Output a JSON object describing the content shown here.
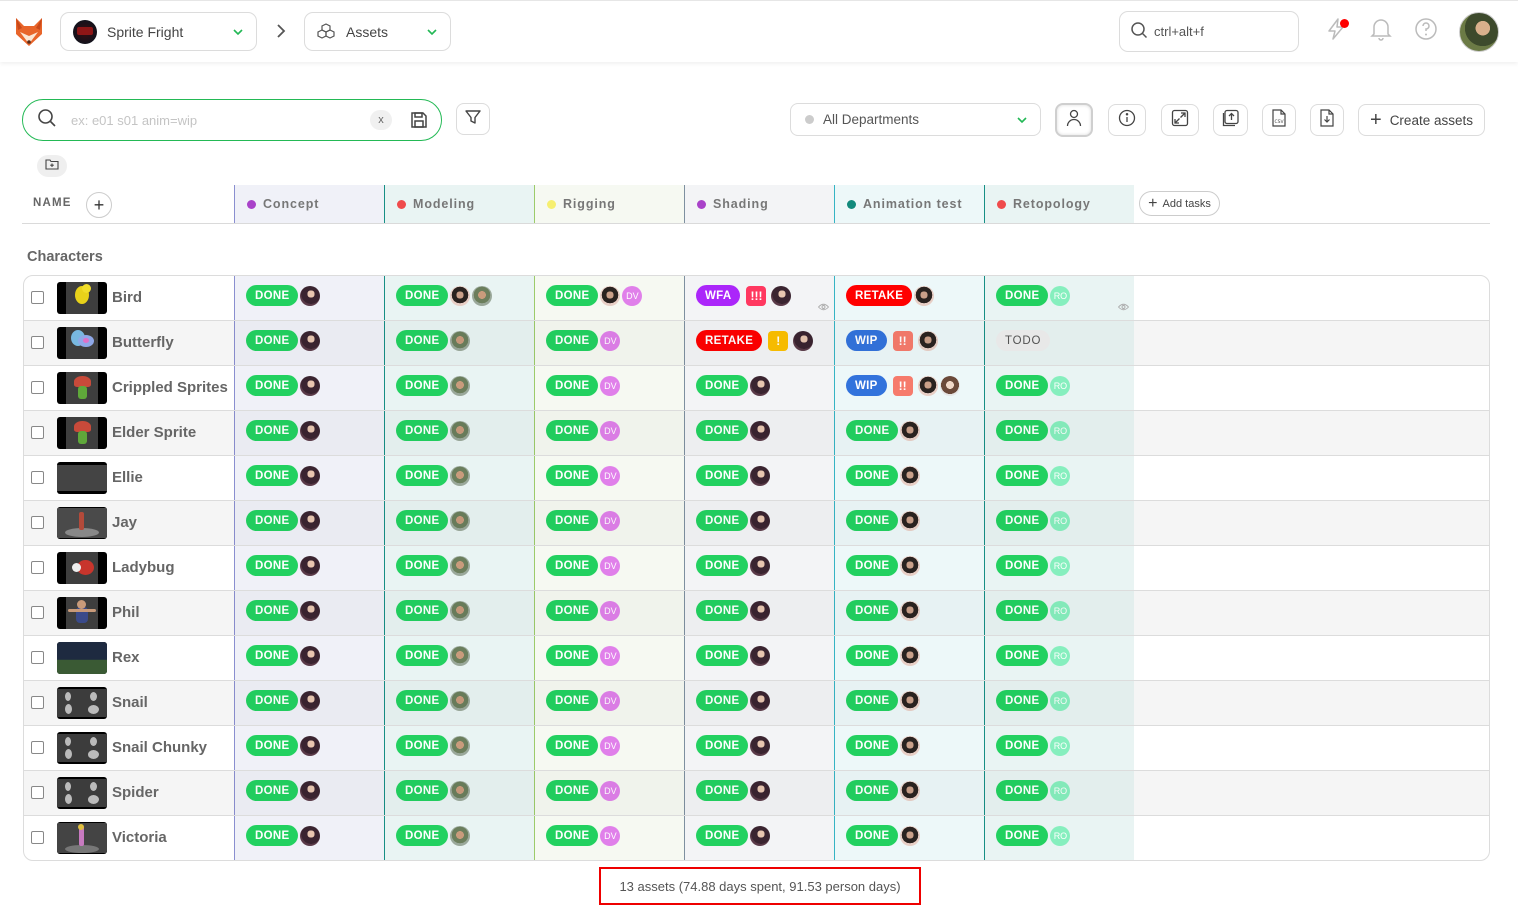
{
  "topbar": {
    "production": "Sprite Fright",
    "section": "Assets",
    "global_search_placeholder": "ctrl+alt+f"
  },
  "toolbar": {
    "search_placeholder": "ex: e01 s01 anim=wip",
    "clear_label": "x",
    "department": "All Departments",
    "create_label": "Create assets",
    "add_tasks_label": "Add tasks"
  },
  "table": {
    "name_header": "NAME",
    "group": "Characters",
    "tasks": [
      {
        "name": "Concept",
        "color": "#a942c9",
        "bg": "#f0f1f8",
        "border": "#8a8fd0"
      },
      {
        "name": "Modeling",
        "color": "#ef4b4b",
        "bg": "#e9f4f3",
        "border": "#178f85"
      },
      {
        "name": "Rigging",
        "color": "#f6ef70",
        "bg": "#f6f9f2",
        "border": "#9ccb6a"
      },
      {
        "name": "Shading",
        "color": "#a942c9",
        "bg": "#f3f4f6",
        "border": "#7e90a0"
      },
      {
        "name": "Animation test",
        "color": "#128a7c",
        "bg": "#edf8f9",
        "border": "#35b4c4"
      },
      {
        "name": "Retopology",
        "color": "#ef4b4b",
        "bg": "#e9f4f3",
        "border": "#178f85"
      }
    ],
    "status_colors": {
      "DONE": "#22d160",
      "WFA": "#ab26fa",
      "RETAKE": "#ff0000",
      "WIP": "#3273dc",
      "TODO": "#eeeeee"
    },
    "priority_colors": {
      "!!!": "#ff3860",
      "!!": "#f67b6c",
      "!": "#fcc000"
    },
    "rows": [
      {
        "name": "Bird",
        "thumb": "bird",
        "cells": [
          {
            "status": "DONE",
            "people": [
              "dark"
            ]
          },
          {
            "status": "DONE",
            "people": [
              "girl",
              "man"
            ]
          },
          {
            "status": "DONE",
            "people": [
              "girl",
              "DV"
            ]
          },
          {
            "status": "WFA",
            "priority": "!!!",
            "people": [
              "dark"
            ],
            "eye": true
          },
          {
            "status": "RETAKE",
            "people": [
              "girl"
            ]
          },
          {
            "status": "DONE",
            "people": [
              "RO"
            ],
            "eye": true
          }
        ]
      },
      {
        "name": "Butterfly",
        "thumb": "butterfly",
        "cells": [
          {
            "status": "DONE",
            "people": [
              "dark"
            ]
          },
          {
            "status": "DONE",
            "people": [
              "man"
            ]
          },
          {
            "status": "DONE",
            "people": [
              "DV"
            ]
          },
          {
            "status": "RETAKE",
            "priority": "!",
            "people": [
              "dark"
            ]
          },
          {
            "status": "WIP",
            "priority": "!!",
            "people": [
              "girl"
            ]
          },
          {
            "status": "TODO",
            "people": []
          }
        ]
      },
      {
        "name": "Crippled Sprites",
        "thumb": "mushroom",
        "cells": [
          {
            "status": "DONE",
            "people": [
              "dark"
            ]
          },
          {
            "status": "DONE",
            "people": [
              "man"
            ]
          },
          {
            "status": "DONE",
            "people": [
              "DV"
            ]
          },
          {
            "status": "DONE",
            "people": [
              "dark"
            ]
          },
          {
            "status": "WIP",
            "priority": "!!",
            "people": [
              "girl",
              "pale"
            ]
          },
          {
            "status": "DONE",
            "people": [
              "RO"
            ]
          }
        ]
      },
      {
        "name": "Elder Sprite",
        "thumb": "mushroom",
        "cells": [
          {
            "status": "DONE",
            "people": [
              "dark"
            ]
          },
          {
            "status": "DONE",
            "people": [
              "man"
            ]
          },
          {
            "status": "DONE",
            "people": [
              "DV"
            ]
          },
          {
            "status": "DONE",
            "people": [
              "dark"
            ]
          },
          {
            "status": "DONE",
            "people": [
              "girl"
            ]
          },
          {
            "status": "DONE",
            "people": [
              "RO"
            ]
          }
        ]
      },
      {
        "name": "Ellie",
        "thumb": "blank",
        "cells": [
          {
            "status": "DONE",
            "people": [
              "dark"
            ]
          },
          {
            "status": "DONE",
            "people": [
              "man"
            ]
          },
          {
            "status": "DONE",
            "people": [
              "DV"
            ]
          },
          {
            "status": "DONE",
            "people": [
              "dark"
            ]
          },
          {
            "status": "DONE",
            "people": [
              "girl"
            ]
          },
          {
            "status": "DONE",
            "people": [
              "RO"
            ]
          }
        ]
      },
      {
        "name": "Jay",
        "thumb": "jay",
        "cells": [
          {
            "status": "DONE",
            "people": [
              "dark"
            ]
          },
          {
            "status": "DONE",
            "people": [
              "man"
            ]
          },
          {
            "status": "DONE",
            "people": [
              "DV"
            ]
          },
          {
            "status": "DONE",
            "people": [
              "dark"
            ]
          },
          {
            "status": "DONE",
            "people": [
              "girl"
            ]
          },
          {
            "status": "DONE",
            "people": [
              "RO"
            ]
          }
        ]
      },
      {
        "name": "Ladybug",
        "thumb": "ladybug",
        "cells": [
          {
            "status": "DONE",
            "people": [
              "dark"
            ]
          },
          {
            "status": "DONE",
            "people": [
              "man"
            ]
          },
          {
            "status": "DONE",
            "people": [
              "DV"
            ]
          },
          {
            "status": "DONE",
            "people": [
              "dark"
            ]
          },
          {
            "status": "DONE",
            "people": [
              "girl"
            ]
          },
          {
            "status": "DONE",
            "people": [
              "RO"
            ]
          }
        ]
      },
      {
        "name": "Phil",
        "thumb": "phil",
        "cells": [
          {
            "status": "DONE",
            "people": [
              "dark"
            ]
          },
          {
            "status": "DONE",
            "people": [
              "man"
            ]
          },
          {
            "status": "DONE",
            "people": [
              "DV"
            ]
          },
          {
            "status": "DONE",
            "people": [
              "dark"
            ]
          },
          {
            "status": "DONE",
            "people": [
              "girl"
            ]
          },
          {
            "status": "DONE",
            "people": [
              "RO"
            ]
          }
        ]
      },
      {
        "name": "Rex",
        "thumb": "rex",
        "cells": [
          {
            "status": "DONE",
            "people": [
              "dark"
            ]
          },
          {
            "status": "DONE",
            "people": [
              "man"
            ]
          },
          {
            "status": "DONE",
            "people": [
              "DV"
            ]
          },
          {
            "status": "DONE",
            "people": [
              "dark"
            ]
          },
          {
            "status": "DONE",
            "people": [
              "girl"
            ]
          },
          {
            "status": "DONE",
            "people": [
              "RO"
            ]
          }
        ]
      },
      {
        "name": "Snail",
        "thumb": "multi",
        "cells": [
          {
            "status": "DONE",
            "people": [
              "dark"
            ]
          },
          {
            "status": "DONE",
            "people": [
              "man"
            ]
          },
          {
            "status": "DONE",
            "people": [
              "DV"
            ]
          },
          {
            "status": "DONE",
            "people": [
              "dark"
            ]
          },
          {
            "status": "DONE",
            "people": [
              "girl"
            ]
          },
          {
            "status": "DONE",
            "people": [
              "RO"
            ]
          }
        ]
      },
      {
        "name": "Snail Chunky",
        "thumb": "multi",
        "cells": [
          {
            "status": "DONE",
            "people": [
              "dark"
            ]
          },
          {
            "status": "DONE",
            "people": [
              "man"
            ]
          },
          {
            "status": "DONE",
            "people": [
              "DV"
            ]
          },
          {
            "status": "DONE",
            "people": [
              "dark"
            ]
          },
          {
            "status": "DONE",
            "people": [
              "girl"
            ]
          },
          {
            "status": "DONE",
            "people": [
              "RO"
            ]
          }
        ]
      },
      {
        "name": "Spider",
        "thumb": "multi",
        "cells": [
          {
            "status": "DONE",
            "people": [
              "dark"
            ]
          },
          {
            "status": "DONE",
            "people": [
              "man"
            ]
          },
          {
            "status": "DONE",
            "people": [
              "DV"
            ]
          },
          {
            "status": "DONE",
            "people": [
              "dark"
            ]
          },
          {
            "status": "DONE",
            "people": [
              "girl"
            ]
          },
          {
            "status": "DONE",
            "people": [
              "RO"
            ]
          }
        ]
      },
      {
        "name": "Victoria",
        "thumb": "victoria",
        "cells": [
          {
            "status": "DONE",
            "people": [
              "dark"
            ]
          },
          {
            "status": "DONE",
            "people": [
              "man"
            ]
          },
          {
            "status": "DONE",
            "people": [
              "DV"
            ]
          },
          {
            "status": "DONE",
            "people": [
              "dark"
            ]
          },
          {
            "status": "DONE",
            "people": [
              "girl"
            ]
          },
          {
            "status": "DONE",
            "people": [
              "RO"
            ]
          }
        ]
      }
    ]
  },
  "footer": {
    "summary": "13 assets (74.88 days spent, 91.53 person days)"
  }
}
